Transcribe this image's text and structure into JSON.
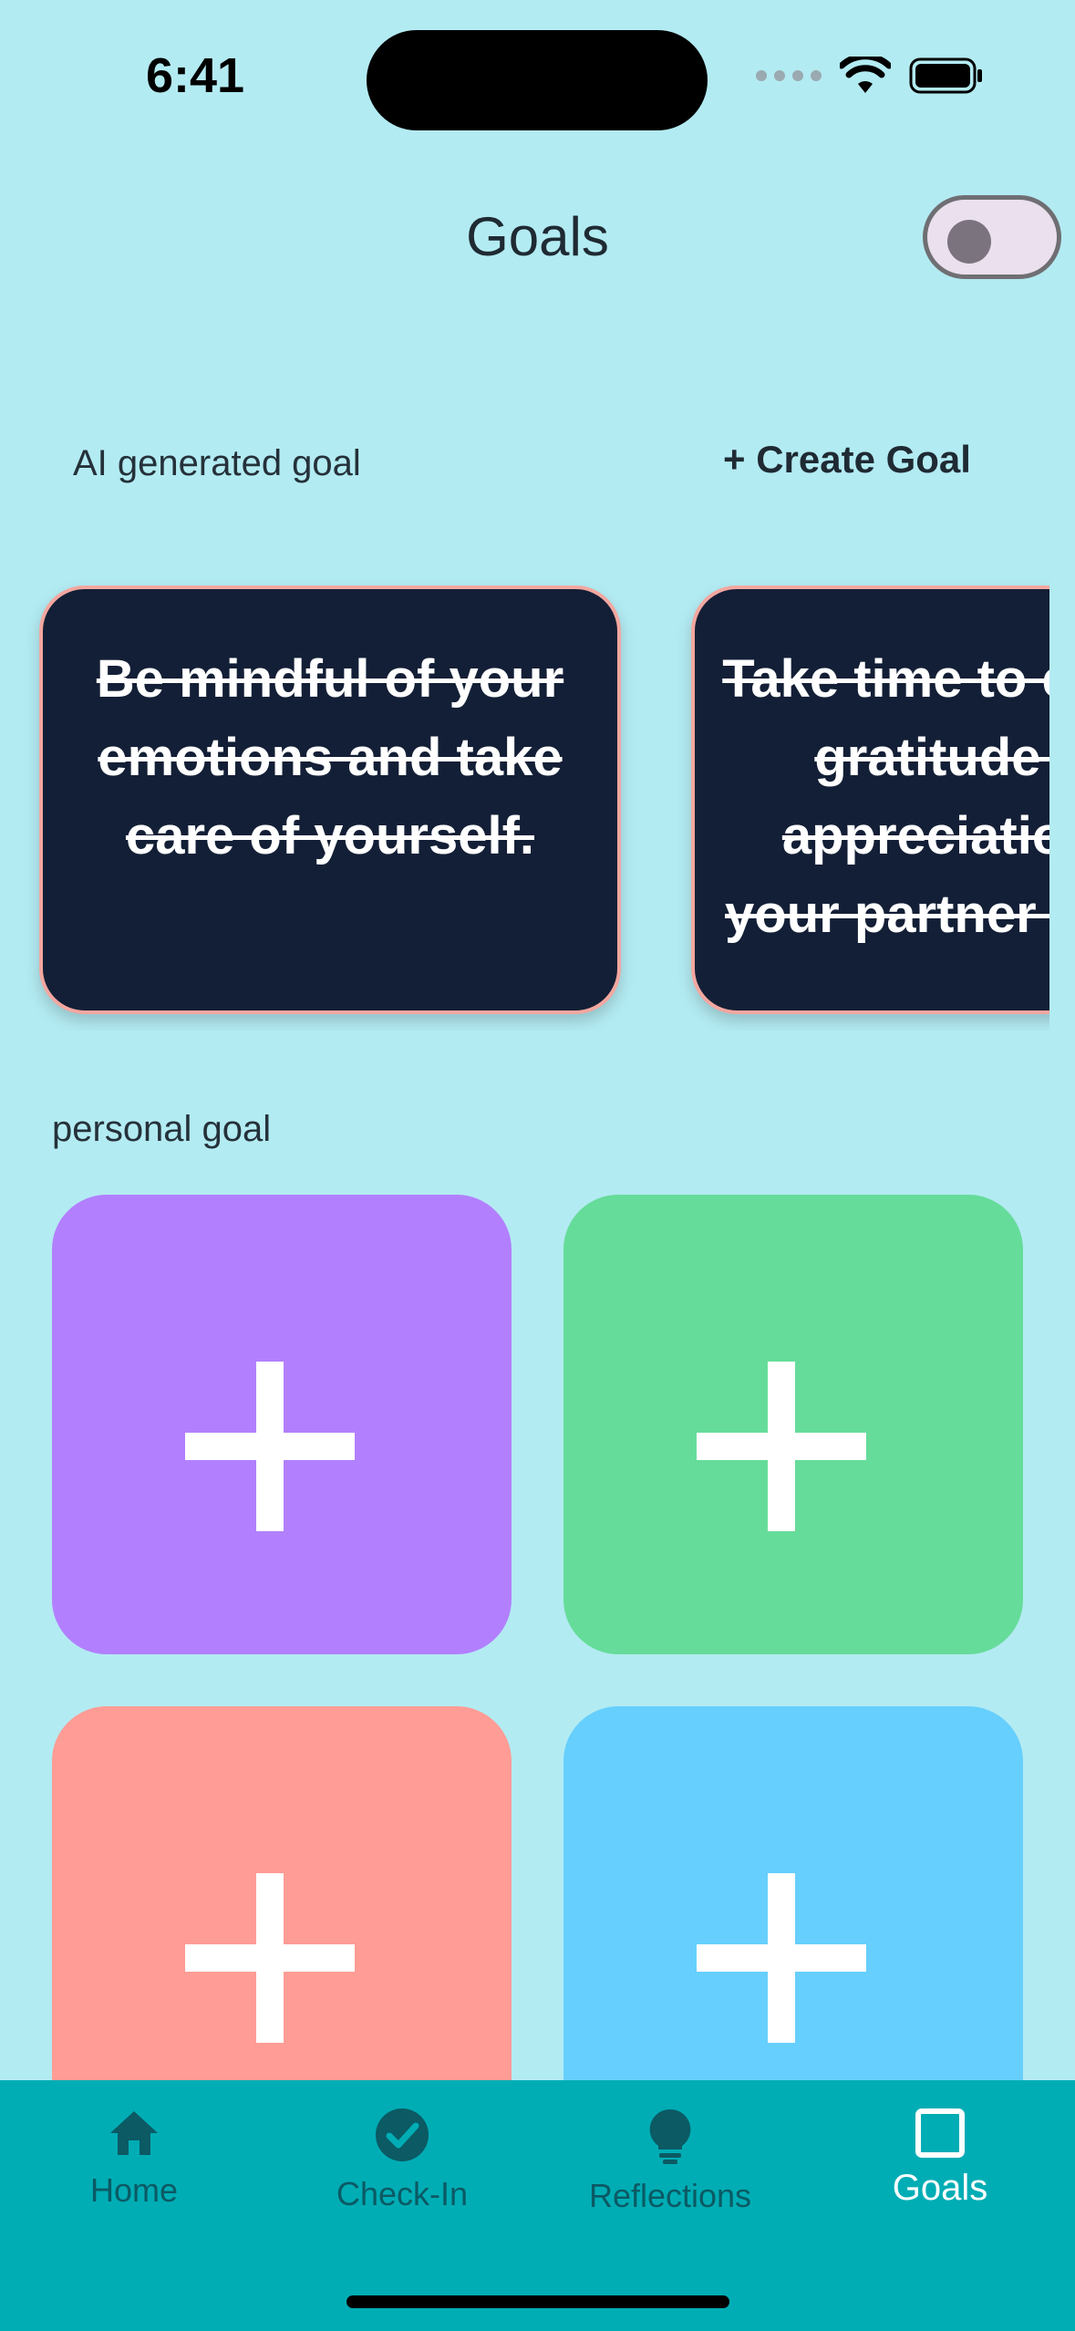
{
  "status_bar": {
    "time": "6:41"
  },
  "header": {
    "title": "Goals",
    "toggle_on": false
  },
  "ai_section": {
    "label": "AI generated goal",
    "create_label": "+ Create Goal",
    "cards": [
      {
        "text": "Be mindful of your emotions and take care of yourself."
      },
      {
        "text": "Take time to express gratitude and appreciation for your partner and job"
      }
    ]
  },
  "personal_section": {
    "label": "personal goal",
    "tiles": [
      {
        "color": "#b280fe"
      },
      {
        "color": "#66dc9a"
      },
      {
        "color": "#fe9c95"
      },
      {
        "color": "#66cffd"
      }
    ]
  },
  "nav": {
    "items": [
      {
        "label": "Home",
        "icon": "home-icon"
      },
      {
        "label": "Check-In",
        "icon": "check-circle-icon"
      },
      {
        "label": "Reflections",
        "icon": "lightbulb-icon"
      },
      {
        "label": "Goals",
        "icon": "square-icon",
        "active": true
      }
    ]
  }
}
